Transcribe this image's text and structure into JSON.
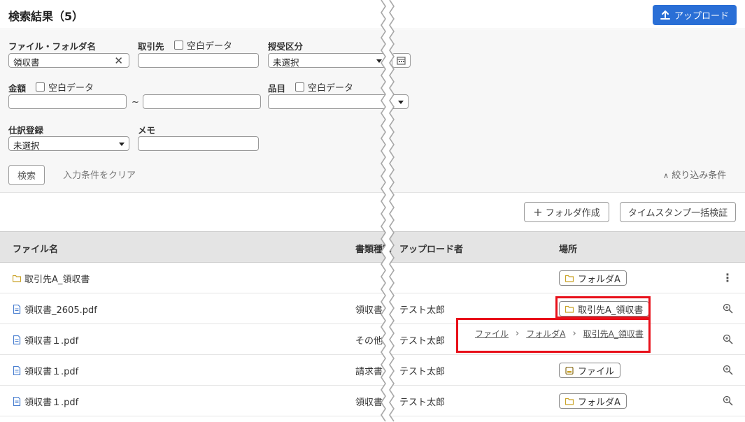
{
  "header": {
    "title": "検索結果（5）",
    "upload_label": "アップロード"
  },
  "filters": {
    "file_folder_name": {
      "label": "ファイル・フォルダ名",
      "value": "領収書"
    },
    "client": {
      "label": "取引先",
      "blank_label": "空白データ",
      "value": ""
    },
    "transfer_type": {
      "label": "授受区分",
      "value": "未選択"
    },
    "amount": {
      "label": "金額",
      "blank_label": "空白データ",
      "from": "",
      "to": "",
      "tilde": "~"
    },
    "item": {
      "label": "品目",
      "blank_label": "空白データ",
      "value": ""
    },
    "journal": {
      "label": "仕訳登録",
      "value": "未選択"
    },
    "memo": {
      "label": "メモ",
      "value": ""
    },
    "search_label": "検索",
    "clear_label": "入力条件をクリア",
    "narrow_label": "絞り込み条件"
  },
  "toolbar": {
    "new_folder_label": "フォルダ作成",
    "timestamp_label": "タイムスタンプ一括検証"
  },
  "table": {
    "headers": {
      "name": "ファイル名",
      "doc_type": "書類種別",
      "uploader": "アップロード者",
      "location": "場所"
    },
    "rows": [
      {
        "name": "取引先A_領収書",
        "type": "folder",
        "doc_type": "",
        "uploader": "",
        "location": "フォルダA"
      },
      {
        "name": "領収書_2605.pdf",
        "type": "file",
        "doc_type": "領収書",
        "uploader": "テスト太郎",
        "location": "取引先A_領収書"
      },
      {
        "name": "領収書１.pdf",
        "type": "file",
        "doc_type": "その他",
        "uploader": "テスト太郎",
        "location": ""
      },
      {
        "name": "領収書１.pdf",
        "type": "file",
        "doc_type": "請求書",
        "uploader": "テスト太郎",
        "location": "ファイル"
      },
      {
        "name": "領収書１.pdf",
        "type": "file",
        "doc_type": "領収書",
        "uploader": "テスト太郎",
        "location": "フォルダA"
      }
    ]
  },
  "breadcrumb": {
    "items": [
      "ファイル",
      "フォルダA",
      "取引先A_領収書"
    ]
  },
  "colors": {
    "accent": "#2a6fd6",
    "highlight": "#e8101a",
    "folder": "#c9a227",
    "file": "#4a7fd0"
  }
}
